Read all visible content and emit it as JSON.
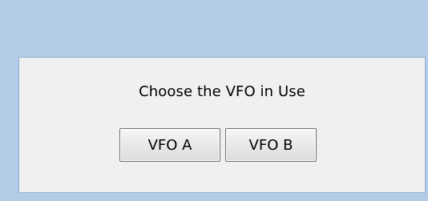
{
  "dialog": {
    "prompt": "Choose the VFO in Use",
    "buttons": {
      "vfo_a": "VFO A",
      "vfo_b": "VFO B"
    }
  },
  "colors": {
    "frame": "#b3cbe6",
    "body": "#f0f0f0",
    "border": "#93b0d0"
  }
}
